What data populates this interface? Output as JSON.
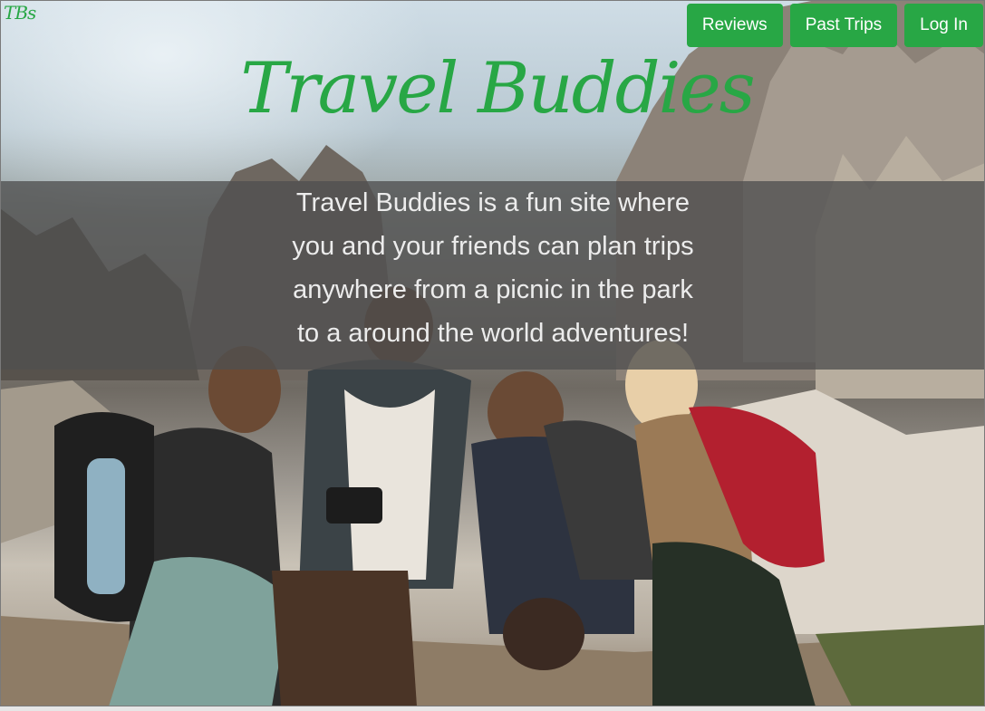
{
  "brand": {
    "logo_text": "TBs",
    "title": "Travel Buddies",
    "accent_color": "#28a745"
  },
  "nav": {
    "items": [
      {
        "label": "Reviews"
      },
      {
        "label": "Past Trips"
      },
      {
        "label": "Log In"
      }
    ]
  },
  "hero": {
    "tagline_lines": [
      "Travel Buddies is a fun site where",
      "you and your friends can plan trips",
      "anywhere from a picnic in the park",
      "to a around the world adventures!"
    ],
    "background_image": "group-of-hikers-in-mountains"
  }
}
